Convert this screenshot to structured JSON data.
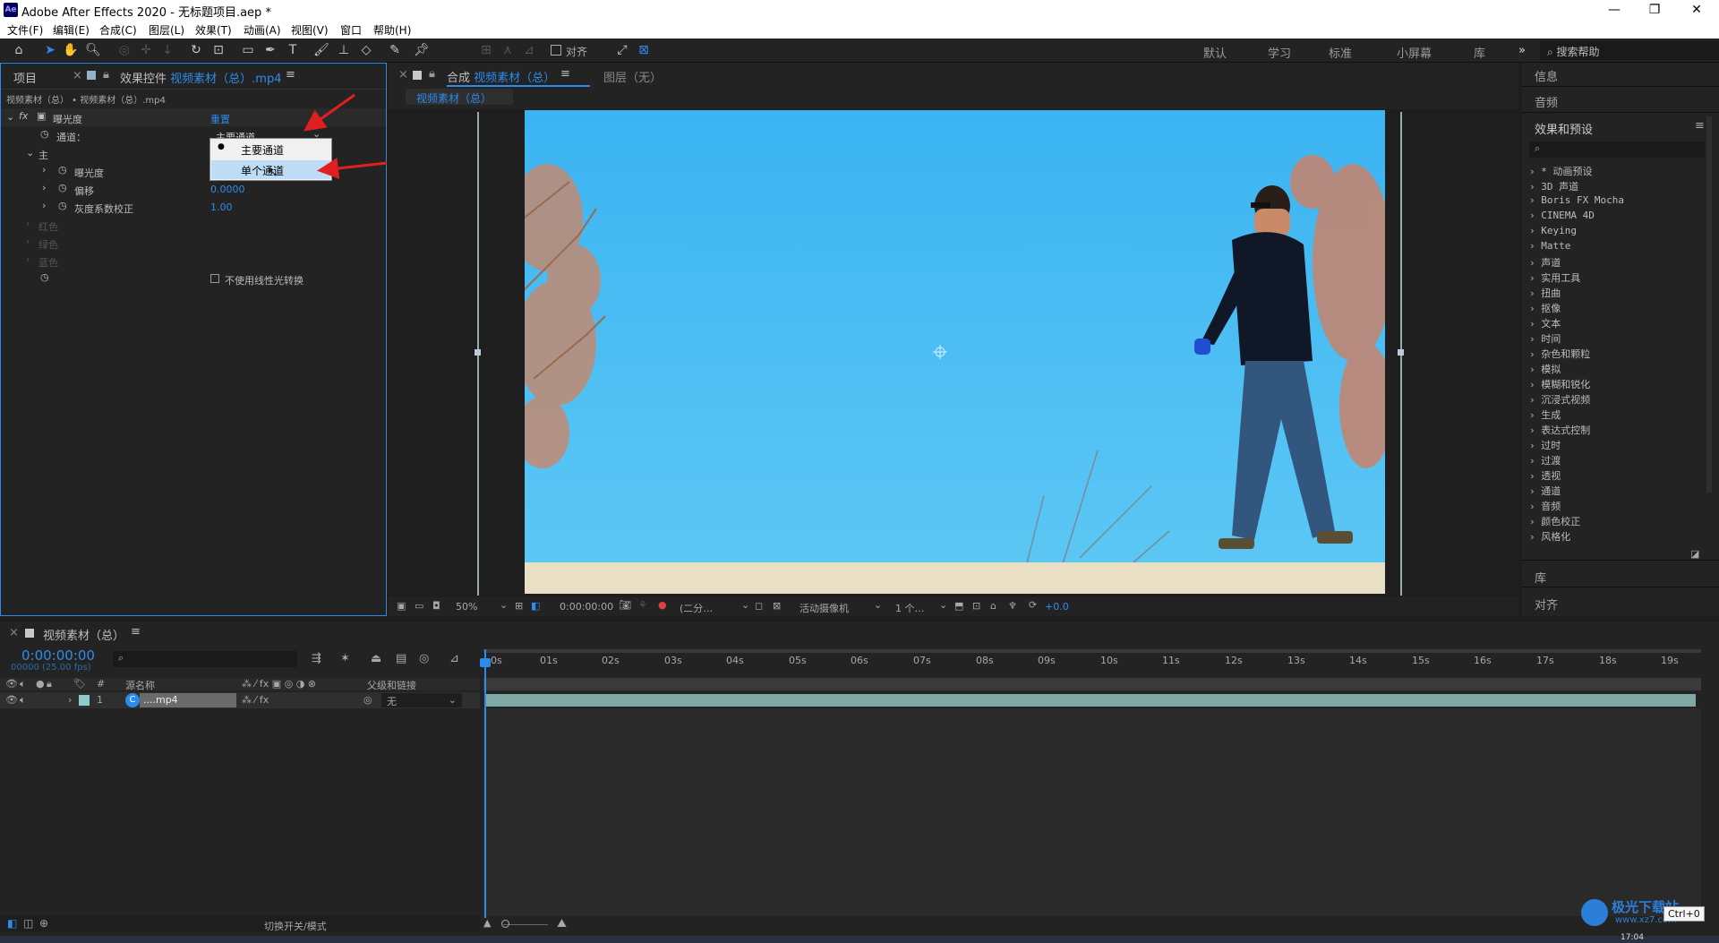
{
  "window": {
    "title": "Adobe After Effects 2020 - 无标题项目.aep *",
    "app_icon": "Ae"
  },
  "menu": [
    "文件(F)",
    "编辑(E)",
    "合成(C)",
    "图层(L)",
    "效果(T)",
    "动画(A)",
    "视图(V)",
    "窗口",
    "帮助(H)"
  ],
  "toolbar": {
    "align_label": "对齐",
    "workspaces": [
      "默认",
      "学习",
      "标准",
      "小屏幕",
      "库"
    ],
    "search_placeholder": "搜索帮助"
  },
  "fx_panel": {
    "tab_project": "项目",
    "tab_effects_prefix": "效果控件",
    "tab_effects_file": "视频素材（总）.mp4",
    "breadcrumb": "视频素材（总） • 视频素材（总）.mp4",
    "effect_name": "曝光度",
    "reset": "重置",
    "channel_label": "通道：",
    "channel_value": "主要通道",
    "group_main": "主",
    "exposure_label": "曝光度",
    "offset_label": "偏移",
    "offset_value": "0.0000",
    "gamma_label": "灰度系数校正",
    "gamma_value": "1.00",
    "red": "红色",
    "green": "绿色",
    "blue_c": "蓝色",
    "linear_label": "不使用线性光转换",
    "dropdown": [
      "主要通道",
      "单个通道"
    ]
  },
  "viewer": {
    "tab_prefix": "合成",
    "tab_name": "视频素材（总）",
    "layer_tab": "图层（无）",
    "comp_chip": "视频素材（总）",
    "zoom": "50%",
    "timecode": "0:00:00:00",
    "resolution": "(二分…",
    "camera": "活动摄像机",
    "views": "1 个…",
    "exposure": "+0.0"
  },
  "right_panel": {
    "info": "信息",
    "audio": "音频",
    "effects_title": "效果和预设",
    "effects": [
      "* 动画预设",
      "3D 声道",
      "Boris FX Mocha",
      "CINEMA 4D",
      "Keying",
      "Matte",
      "声道",
      "实用工具",
      "扭曲",
      "抠像",
      "文本",
      "时间",
      "杂色和颗粒",
      "模拟",
      "模糊和锐化",
      "沉浸式视频",
      "生成",
      "表达式控制",
      "过时",
      "过渡",
      "透视",
      "通道",
      "音频",
      "颜色校正",
      "风格化"
    ],
    "library": "库",
    "align": "对齐"
  },
  "timeline": {
    "tab": "视频素材（总）",
    "timecode": "0:00:00:00",
    "fps": "00000 (25.00 fps)",
    "col_source": "源名称",
    "col_parent": "父级和链接",
    "layer_num": "1",
    "layer_name": "....mp4",
    "parent_value": "无",
    "toggle_label": "切换开关/模式",
    "ruler": [
      "0s",
      "01s",
      "02s",
      "03s",
      "04s",
      "05s",
      "06s",
      "07s",
      "08s",
      "09s",
      "10s",
      "11s",
      "12s",
      "13s",
      "14s",
      "15s",
      "16s",
      "17s",
      "18s",
      "19s"
    ]
  },
  "taskbar": {
    "time": "17:04"
  },
  "watermark": {
    "brand": "极光下载站",
    "url": "www.xz7.com",
    "tooltip": "Ctrl+0"
  }
}
